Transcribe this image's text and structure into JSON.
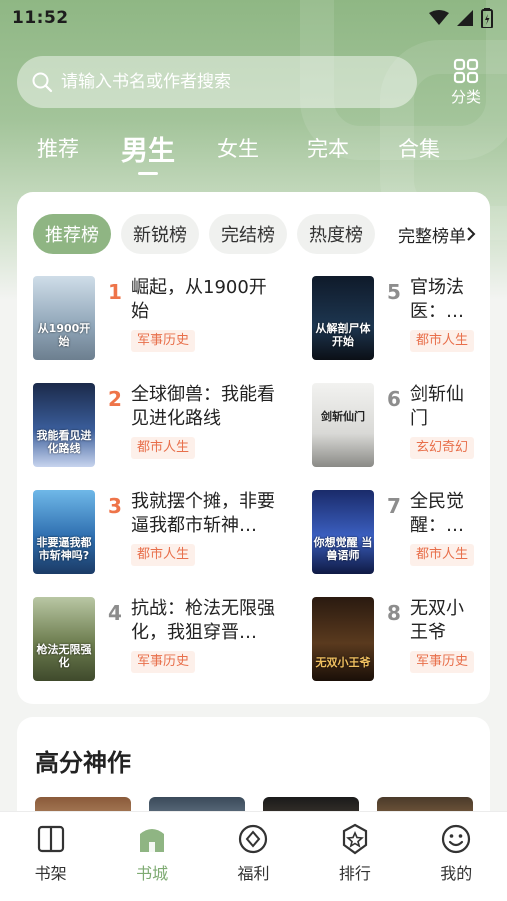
{
  "status_bar": {
    "time": "11:52"
  },
  "search": {
    "placeholder": "请输入书名或作者搜索",
    "category_label": "分类"
  },
  "gender_tabs": [
    {
      "label": "推荐"
    },
    {
      "label": "男生",
      "active": true
    },
    {
      "label": "女生"
    },
    {
      "label": "完本"
    },
    {
      "label": "合集"
    }
  ],
  "rank_tabs": [
    {
      "label": "推荐榜",
      "active": true
    },
    {
      "label": "新锐榜"
    },
    {
      "label": "完结榜"
    },
    {
      "label": "热度榜"
    }
  ],
  "full_list_label": "完整榜单",
  "books": [
    {
      "rank": "1",
      "title": "崛起，从1900开始",
      "tag": "军事历史",
      "cover_text": "从1900开始"
    },
    {
      "rank": "2",
      "title": "全球御兽：我能看见进化路线",
      "tag": "都市人生",
      "cover_text": "我能看见进化路线"
    },
    {
      "rank": "3",
      "title": "我就摆个摊，非要逼我都市斩神…",
      "tag": "都市人生",
      "cover_text": "非要逼我都市斩神吗?"
    },
    {
      "rank": "4",
      "title": "抗战：枪法无限强化，我狙穿晋…",
      "tag": "军事历史",
      "cover_text": "枪法无限强化"
    },
    {
      "rank": "5",
      "title": "官场法医：从解剖尸体开始",
      "tag": "都市人生",
      "cover_text": "从解剖尸体开始"
    },
    {
      "rank": "6",
      "title": "剑斩仙门",
      "tag": "玄幻奇幻",
      "cover_text": "剑斩仙门"
    },
    {
      "rank": "7",
      "title": "全民觉醒：禁咒当兽",
      "tag": "都市人生",
      "cover_text": "你想觉醒 当兽语师"
    },
    {
      "rank": "8",
      "title": "无双小王爷",
      "tag": "军事历史",
      "cover_text": "无双小王爷"
    }
  ],
  "high_score": {
    "title": "高分神作"
  },
  "bottom_nav": [
    {
      "label": "书架"
    },
    {
      "label": "书城",
      "active": true
    },
    {
      "label": "福利"
    },
    {
      "label": "排行"
    },
    {
      "label": "我的"
    }
  ],
  "colors": {
    "accent": "#8fb583",
    "tag_text": "#e86f4b",
    "rank_top": "#ee7449"
  }
}
